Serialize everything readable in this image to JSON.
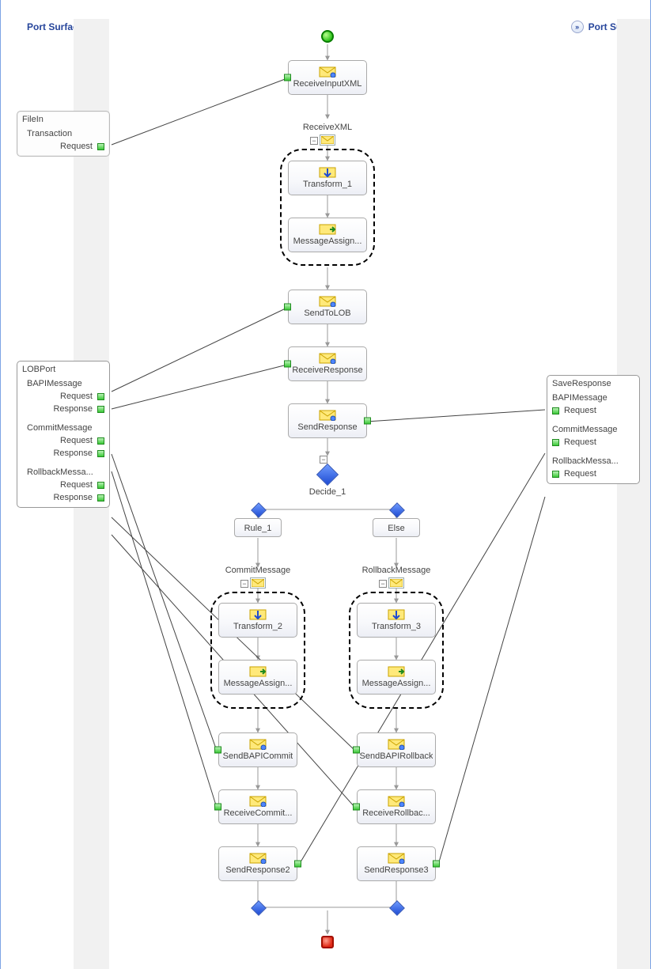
{
  "headers": {
    "left_label": "Port Surface",
    "right_label": "Port Surface",
    "left_chev": "«",
    "right_chev": "»"
  },
  "ports": {
    "filein": {
      "name": "FileIn",
      "op": "Transaction",
      "msgs": {
        "request": "Request"
      }
    },
    "lobport": {
      "name": "LOBPort",
      "ops": {
        "bapi": {
          "label": "BAPIMessage",
          "request": "Request",
          "response": "Response"
        },
        "commit": {
          "label": "CommitMessage",
          "request": "Request",
          "response": "Response"
        },
        "rollback": {
          "label": "RollbackMessa...",
          "request": "Request",
          "response": "Response"
        }
      }
    },
    "save": {
      "name": "SaveResponse",
      "ops": {
        "bapi": {
          "label": "BAPIMessage",
          "request": "Request"
        },
        "commit": {
          "label": "CommitMessage",
          "request": "Request"
        },
        "rollback": {
          "label": "RollbackMessa...",
          "request": "Request"
        }
      }
    }
  },
  "shapes": {
    "receive_input": "ReceiveInputXML",
    "scope_receive": "ReceiveXML",
    "transform1": "Transform_1",
    "msgassign1": "MessageAssign...",
    "send_lob": "SendToLOB",
    "recv_resp": "ReceiveResponse",
    "send_resp": "SendResponse",
    "decide": "Decide_1",
    "rule1": "Rule_1",
    "else": "Else",
    "scope_commit": "CommitMessage",
    "transform2": "Transform_2",
    "msgassign2": "MessageAssign...",
    "scope_rollback": "RollbackMessage",
    "transform3": "Transform_3",
    "msgassign3": "MessageAssign...",
    "send_commit": "SendBAPICommit",
    "recv_commit": "ReceiveCommit...",
    "send_resp2": "SendResponse2",
    "send_rollback": "SendBAPIRollback",
    "recv_rollback": "ReceiveRollbac...",
    "send_resp3": "SendResponse3"
  },
  "toggle": "−"
}
